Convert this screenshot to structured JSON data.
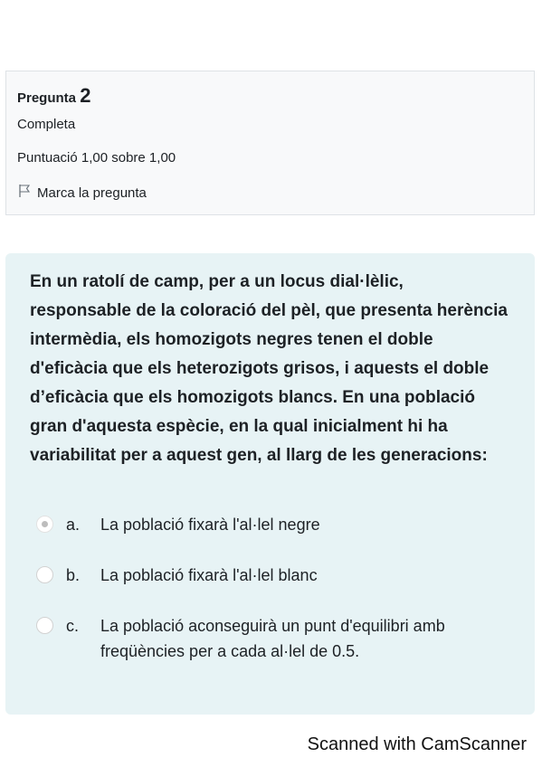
{
  "info": {
    "question_label": "Pregunta",
    "question_number": "2",
    "state": "Completa",
    "grade": "Puntuació 1,00 sobre 1,00",
    "flag_label": "Marca la pregunta"
  },
  "question": {
    "text": "En un ratolí de camp, per a un locus dial·lèlic, responsable de la coloració del pèl, que presenta herència intermèdia, els homozigots negres tenen el doble d'eficàcia que els heterozigots grisos, i aquests el doble d’eficàcia que els homozigots blancs. En una població gran d'aquesta espècie, en la qual inicialment hi ha variabilitat per a aquest gen, al llarg de les generacions:",
    "answers": [
      {
        "letter": "a.",
        "text": "La població fixarà l'al·lel negre",
        "selected": true
      },
      {
        "letter": "b.",
        "text": "La població fixarà l'al·lel blanc",
        "selected": false
      },
      {
        "letter": "c.",
        "text": "La població aconseguirà un punt d'equilibri amb freqüències per a cada al·lel de 0.5.",
        "selected": false
      }
    ]
  },
  "footer": {
    "text": "Scanned with CamScanner"
  }
}
